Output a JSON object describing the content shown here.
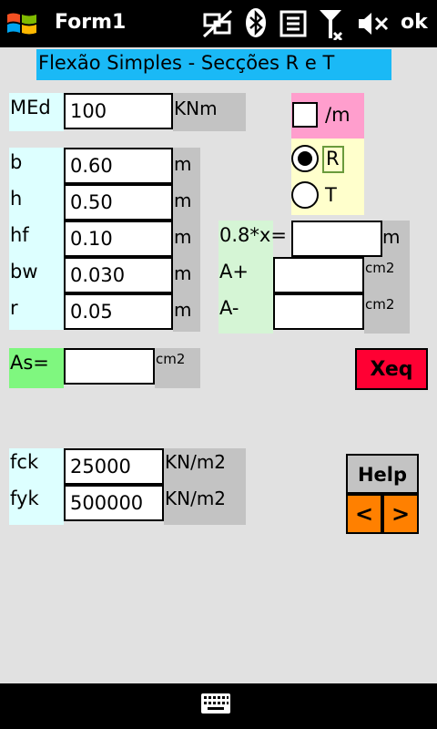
{
  "status_bar": {
    "title": "Form1",
    "ok_label": "ok"
  },
  "heading": "Flexão Simples - Secções  R e T",
  "moment": {
    "label": "MEd",
    "value": "100",
    "unit": "KNm"
  },
  "per_meter": {
    "label": "/m",
    "checked": false
  },
  "section_type": {
    "options": [
      "R",
      "T"
    ],
    "selected": "R"
  },
  "geometry": [
    {
      "label": "b",
      "value": "0.60",
      "unit": "m"
    },
    {
      "label": "h",
      "value": "0.50",
      "unit": "m"
    },
    {
      "label": "hf",
      "value": "0.10",
      "unit": "m"
    },
    {
      "label": "bw",
      "value": "0.030",
      "unit": "m"
    },
    {
      "label": "r",
      "value": "0.05",
      "unit": "m"
    }
  ],
  "results": {
    "x": {
      "label": "0.8*x=",
      "value": "",
      "unit": "m"
    },
    "a_plus": {
      "label": "A+",
      "value": "",
      "unit": "cm2"
    },
    "a_minus": {
      "label": "A-",
      "value": "",
      "unit": "cm2"
    }
  },
  "as_result": {
    "label": "As=",
    "value": "",
    "unit": "cm2"
  },
  "xeq_button": "Xeq",
  "materials": [
    {
      "label": "fck",
      "value": "25000",
      "unit": "KN/m2"
    },
    {
      "label": "fyk",
      "value": "500000",
      "unit": "KN/m2"
    }
  ],
  "help_button": "Help",
  "prev_button": "<",
  "next_button": ">",
  "colors": {
    "heading_bg": "#1ab9f6",
    "label_bg": "#ddffff",
    "unit_bg": "#c3c3c3",
    "pink": "#ff9ecd",
    "cream": "#ffffcc",
    "mint": "#d5f5d5",
    "green": "#7ff77f",
    "red": "#ff0033",
    "orange": "#ff8000"
  }
}
